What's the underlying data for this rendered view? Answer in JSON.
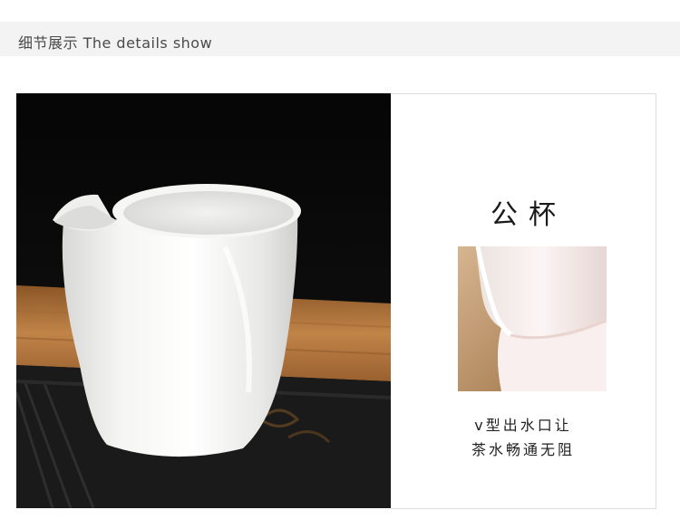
{
  "header": {
    "title": "细节展示 The details show"
  },
  "product": {
    "title": "公杯",
    "caption_line1": "v型出水口让",
    "caption_line2": "茶水畅通无阻"
  },
  "colors": {
    "header_bg": "#f3f3f3",
    "porcelain": "#f4f4f2",
    "wood": "#b0743a",
    "tray": "#1c1c1c"
  }
}
